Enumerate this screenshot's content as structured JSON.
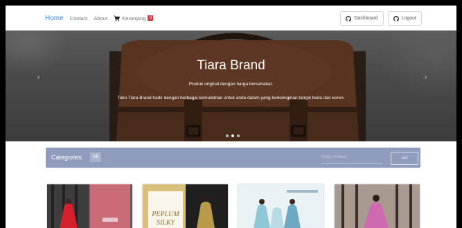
{
  "nav": {
    "home": "Home",
    "contact": "Contact",
    "about": "About",
    "cart_label": "Keranjang",
    "cart_count": "0",
    "dashboard": "Dashboard",
    "logout": "Logout"
  },
  "hero": {
    "title": "Tiara Brand",
    "subtitle": "Produk original dengan harga bersahabat.",
    "description": "Toko Tiara Brand hadir dengan berbagai kemudahan untuk anda dalam yang berkeinginan tampil beda dan keren.",
    "prev_icon": "chevron-left-icon",
    "next_icon": "chevron-right-icon",
    "slides": 3,
    "active_slide": 2
  },
  "categories": {
    "label": "Categories:",
    "all": "All",
    "search_placeholder": "Nama Produk",
    "search_button": "cari"
  },
  "products": [
    {
      "image": "product-photo-red-dress"
    },
    {
      "image": "product-photo-peplum-silky",
      "label_line1": "PEPLUM",
      "label_line2": "SILKY"
    },
    {
      "image": "product-photo-blue-outfits"
    },
    {
      "image": "product-photo-pink-dress"
    }
  ],
  "colors": {
    "home_link": "#3a8bd6",
    "cart_badge": "#d9363e",
    "category_bar": "#8f9cbd"
  }
}
